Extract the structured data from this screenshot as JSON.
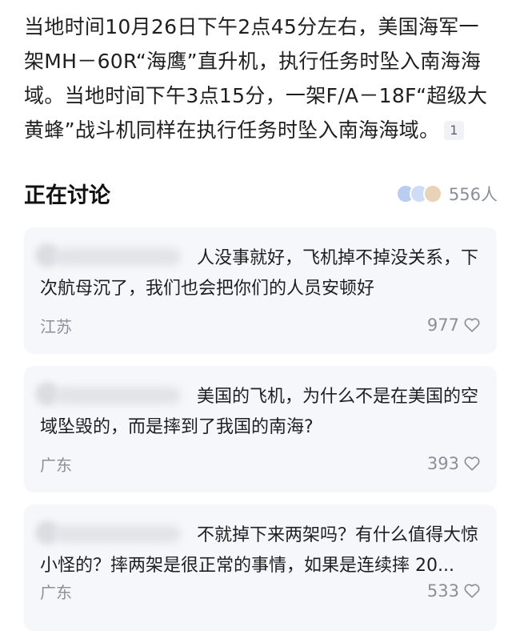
{
  "article": {
    "text": "当地时间10月26日下午2点45分左右，美国海军一架MH－60R“海鹰”直升机，执行任务时坠入南海海域。当地时间下午3点15分，一架F/A－18F“超级大黄蜂”战斗机同样在执行任务时坠入南海海域。",
    "ref_badge": "1"
  },
  "discussion": {
    "title": "正在讨论",
    "participant_count": "556人",
    "avatar_colors": [
      "#b9cdf0",
      "#cfdcf5",
      "#e8d3b8"
    ]
  },
  "comments": [
    {
      "text": "人没事就好，飞机掉不掉没关系，下次航母沉了，我们也会把你们的人员安顿好",
      "location": "江苏",
      "likes": "977"
    },
    {
      "text": "美国的飞机，为什么不是在美国的空域坠毁的，而是摔到了我国的南海?",
      "location": "广东",
      "likes": "393"
    },
    {
      "text": "不就掉下来两架吗？有什么值得大惊小怪的？摔两架是很正常的事情，如果是连续摔 20...",
      "location": "广东",
      "likes": "533"
    }
  ],
  "colors": {
    "text_primary": "#1f1f1f",
    "text_secondary": "#8a8f99",
    "card_background": "#f6f7fa"
  }
}
